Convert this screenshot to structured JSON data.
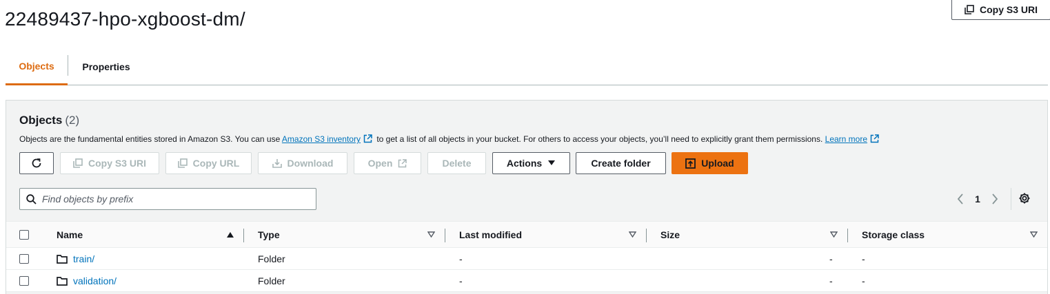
{
  "page_title": "22489437-hpo-xgboost-dm/",
  "top_copy_uri_label": "Copy S3 URI",
  "tabs": [
    {
      "label": "Objects",
      "active": true
    },
    {
      "label": "Properties",
      "active": false
    }
  ],
  "objects_panel": {
    "heading": "Objects",
    "count": "(2)",
    "description_prefix": "Objects are the fundamental entities stored in Amazon S3. You can use",
    "inventory_link": "Amazon S3 inventory",
    "description_middle": "to get a list of all objects in your bucket. For others to access your objects, you’ll need to explicitly grant them permissions.",
    "learn_more_link": "Learn more"
  },
  "toolbar": {
    "refresh_icon": "refresh-icon",
    "copy_s3_uri": "Copy S3 URI",
    "copy_url": "Copy URL",
    "download": "Download",
    "open": "Open",
    "delete": "Delete",
    "actions": "Actions",
    "create_folder": "Create folder",
    "upload": "Upload"
  },
  "search": {
    "placeholder": "Find objects by prefix",
    "value": ""
  },
  "pagination": {
    "current_page": "1"
  },
  "table": {
    "columns": [
      "Name",
      "Type",
      "Last modified",
      "Size",
      "Storage class"
    ],
    "rows": [
      {
        "name": "train/",
        "type": "Folder",
        "last_modified": "-",
        "size": "-",
        "storage_class": "-"
      },
      {
        "name": "validation/",
        "type": "Folder",
        "last_modified": "-",
        "size": "-",
        "storage_class": "-"
      }
    ]
  },
  "colors": {
    "accent_orange": "#ec7211",
    "tab_active": "#dd6b10",
    "link_blue": "#0073bb"
  }
}
